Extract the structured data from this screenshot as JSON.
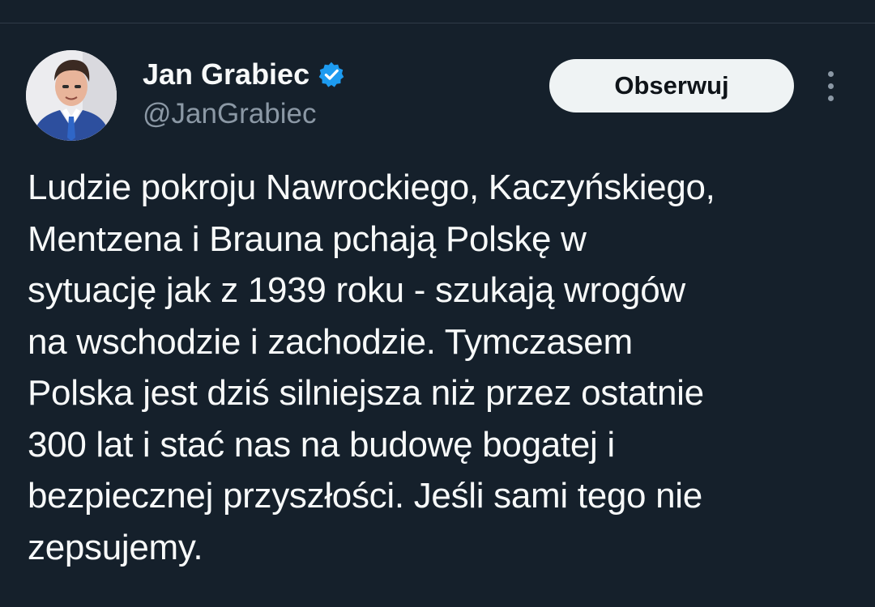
{
  "author": {
    "display_name": "Jan Grabiec",
    "handle": "@JanGrabiec",
    "verified": true,
    "avatar_icon": "profile-photo",
    "verified_icon": "verified-badge-icon"
  },
  "actions": {
    "follow_label": "Obserwuj",
    "more_icon": "more-vertical-icon"
  },
  "tweet": {
    "text": "Ludzie pokroju Nawrockiego, Kaczyńskiego,\nMentzena i Brauna pchają Polskę w\nsytuację jak z 1939 roku - szukają wrogów\nna wschodzie i zachodzie. Tymczasem\nPolska jest dziś silniejsza niż przez ostatnie\n300 lat i stać nas na budowę bogatej i\nbezpiecznej przyszłości. Jeśli sami tego nie\nzepsujemy."
  },
  "colors": {
    "background": "#15202b",
    "text_primary": "#f7f9f9",
    "text_secondary": "#8b98a5",
    "verified_blue": "#1d9bf0",
    "button_background": "#eff3f4"
  }
}
